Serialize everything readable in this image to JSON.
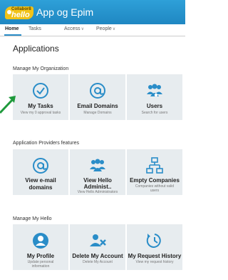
{
  "header": {
    "logo_top": "Collabor8",
    "logo_main": "hello",
    "app_title": "App og Epim"
  },
  "nav": {
    "items": [
      {
        "label": "Home"
      },
      {
        "label": "Tasks"
      },
      {
        "label": "Access"
      },
      {
        "label": "People"
      }
    ]
  },
  "page": {
    "title": "Applications",
    "sections": [
      {
        "title": "Manage My Organization"
      },
      {
        "title": "Application Providers features"
      },
      {
        "title": "Manage My Hello"
      }
    ]
  },
  "tiles": {
    "my_tasks": {
      "title": "My Tasks",
      "subtitle": "View my 0 approval tasks"
    },
    "email_domains": {
      "title": "Email Domains",
      "subtitle": "Manage Domains"
    },
    "users": {
      "title": "Users",
      "subtitle": "Search for users"
    },
    "view_email_domains": {
      "title_line1": "View e-mail",
      "title_line2": "domains"
    },
    "view_hello_admin": {
      "title_line1": "View Hello",
      "title_line2": "Administ..",
      "subtitle": "View Hello Administrators"
    },
    "empty_companies": {
      "title": "Empty Companies",
      "subtitle_line1": "Companies without valid",
      "subtitle_line2": "users"
    },
    "my_profile": {
      "title": "My Profile",
      "subtitle_line1": "Update personal",
      "subtitle_line2": "information"
    },
    "delete_account": {
      "title": "Delete My Account",
      "subtitle": "Delete My Account"
    },
    "request_history": {
      "title": "My Request History",
      "subtitle": "View my request history"
    }
  },
  "colors": {
    "accent": "#1f87c2",
    "icon": "#2a8dc8",
    "tile_bg": "#e7ecef",
    "annotation_arrow": "#1f9a3c"
  }
}
